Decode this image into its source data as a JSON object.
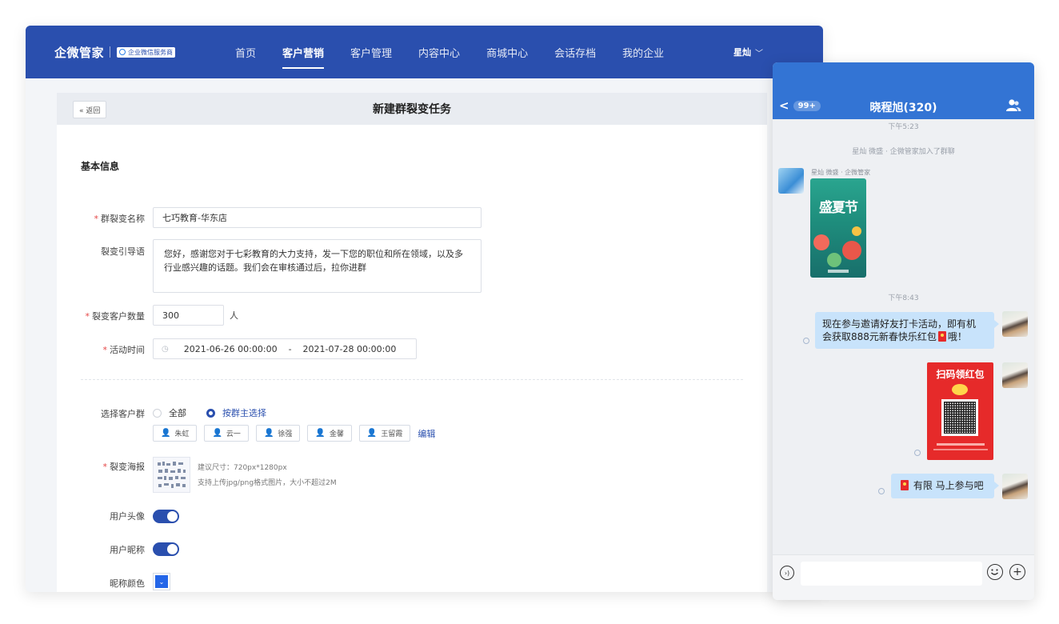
{
  "app": {
    "brand_name": "企微管家",
    "brand_badge": "企业微信服务商",
    "nav": [
      {
        "label": "首页",
        "active": false
      },
      {
        "label": "客户营销",
        "active": true
      },
      {
        "label": "客户管理",
        "active": false
      },
      {
        "label": "内容中心",
        "active": false
      },
      {
        "label": "商城中心",
        "active": false
      },
      {
        "label": "会话存档",
        "active": false
      },
      {
        "label": "我的企业",
        "active": false
      }
    ],
    "user_name": "星灿",
    "user_chevron": "﹀"
  },
  "page": {
    "back_label": "« 返回",
    "title": "新建群裂变任务"
  },
  "form": {
    "section_title": "基本信息",
    "required_mark": "*",
    "name_label": "群裂变名称",
    "name_value": "七巧教育-华东店",
    "guide_label": "裂变引导语",
    "guide_value": "您好，感谢您对于七彩教育的大力支持，发一下您的职位和所在领域，以及多行业感兴趣的话题。我们会在审核通过后，拉你进群",
    "count_label": "裂变客户数量",
    "count_value": "300",
    "count_unit": "人",
    "time_label": "活动时间",
    "time_start": "2021-06-26 00:00:00",
    "time_sep": "-",
    "time_end": "2021-07-28 00:00:00",
    "group_label": "选择客户群",
    "group_options": [
      "全部",
      "按群主选择"
    ],
    "group_selected": "按群主选择",
    "owners": [
      "朱虹",
      "云一",
      "徐强",
      "金馨",
      "王留霞"
    ],
    "edit_label": "编辑",
    "poster_label": "裂变海报",
    "poster_hint_1": "建议尺寸：720px*1280px",
    "poster_hint_2": "支持上传jpg/png格式图片，大小不超过2M",
    "avatar_label": "用户头像",
    "avatar_on": true,
    "nickname_label": "用户昵称",
    "nickname_on": true,
    "nickname_color_label": "昵称颜色",
    "nickname_color": "#2466e8"
  },
  "chat": {
    "back_glyph": "<",
    "unread": "99+",
    "title": "晓程旭(320)",
    "time_1": "下午5:23",
    "system_msg": "星灿 微盛 · 企微管家加入了群聊",
    "sender_name": "星灿 微盛 · 企微管家",
    "poster_title": "盛夏节",
    "time_2": "下午8:43",
    "msg_1_line_1": "现在参与邀请好友打卡活动，即有机",
    "msg_1_line_2a": "会获取888元新春快乐红包",
    "msg_1_line_2b": "哦！",
    "redpack_title": "扫码领红包",
    "msg_3": "有限 马上参与吧",
    "accent": "#3374d4"
  }
}
